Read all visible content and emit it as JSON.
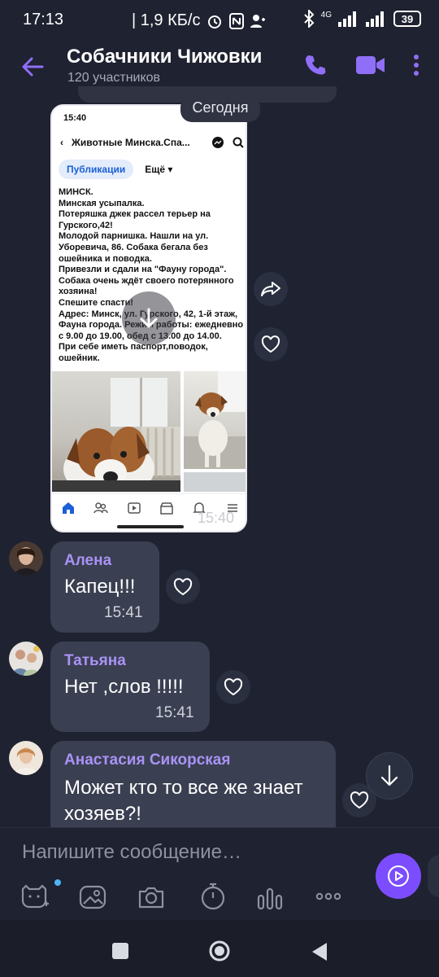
{
  "status_bar": {
    "time": "17:13",
    "speed": "| 1,9 КБ/с",
    "network": "4G",
    "battery": "39"
  },
  "header": {
    "title": "Собачники Чижовки",
    "subtitle": "120 участников"
  },
  "date_badge": "Сегодня",
  "screenshot": {
    "status_time": "15:40",
    "page_title": "Животные Минска.Спа...",
    "tab_publications": "Публикации",
    "tab_more": "Ещё",
    "post_text": "МИНСК.\nМинская усыпалка.\nПотеряшка джек рассел терьер на Гурского,42!\nМолодой парнишка. Нашли на ул. Уборевича, 86. Собака бегала без ошейника и поводка.\nПривезли и сдали на \"Фауну города\".\nСобака очень ждёт своего потерянного хозяина!\nСпешите спасти!\nАдрес: Минск, ул. Гурского, 42, 1-й этаж, Фауна города. Режим работы: ежедневно с 9.00 до 19.00, обед с 13.00 до 14.00.\nПри себе иметь паспорт,поводок, ошейник.",
    "sent_time": "15:40"
  },
  "messages": [
    {
      "sender": "Алена",
      "text": "Капец!!!",
      "time": "15:41"
    },
    {
      "sender": "Татьяна",
      "text": "Нет ,слов !!!!!",
      "time": "15:41"
    },
    {
      "sender": "Анастасия Сикорская",
      "text": "Может кто то все же знает хозяев?!"
    }
  ],
  "input": {
    "placeholder": "Напишите сообщение…"
  },
  "colors": {
    "accent": "#7c4dff",
    "background": "#1f2230",
    "bubble": "#3a3f51",
    "sender": "#a993f5"
  }
}
